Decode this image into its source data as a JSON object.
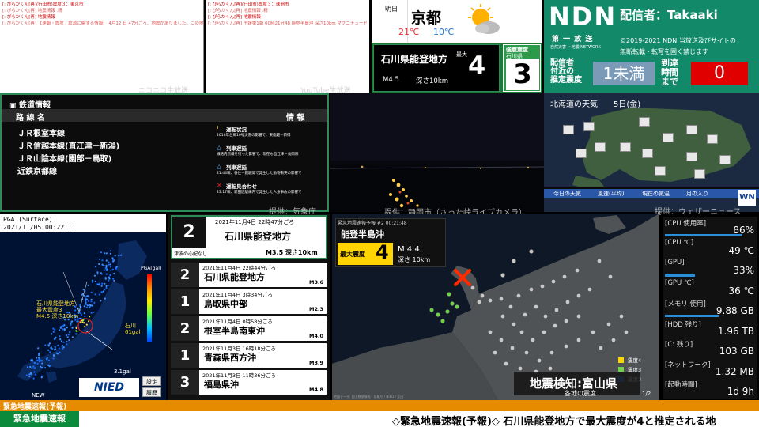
{
  "chat_niconico": {
    "lines": [
      "[: ぴらかくん[再](行田市)震度３：東京市",
      "[: ぴらかくん[再] 地震情報 .精",
      "[: ぴらかくん[再] 地震情報",
      "[: ぴらかくん[再] 【速報・震度 / 震源に関する情報】 4月12 日 47分ごろ、地震がありました。この地震による津波の心配はありません。震源地は石川県能登地方で、震源の深さは約10km、地震の規模（マグニチュード）はM4.5、最大震度は 3 と推定されます。",
      "[: ぴらかくん[再](行田市)震度３：珠洲市",
      "[: ぴらかくん[再] 地震情報 .精",
      "[: ぴらかくん[再] 地震情報",
      "[: ぴらかくん[再] 予報第1報 00時21分48 能登半島沖 深さ10km マグニチュード 4.4 予想震度3"
    ],
    "source": "ニコニコ生放送"
  },
  "chat_youtube": {
    "source": "YouTube生放送"
  },
  "weather": {
    "label": "明日",
    "city": "京都",
    "high": "21℃",
    "low": "10℃",
    "icon": "sun-cloud-icon"
  },
  "quake_top": {
    "region": "石川県能登地方",
    "max_label": "最大",
    "intensity": "4",
    "magnitude": "M4.5",
    "depth": "深さ10km",
    "obs_label": "強震震度",
    "obs_region": "石川県",
    "obs_intensity": "3"
  },
  "ndn": {
    "logo": "NDN",
    "sub": "第 一 放 送",
    "sub2": "自然災害 ・地震 NETWORK",
    "broadcaster": "配信者：Takaaki",
    "copyright": "©2019-2021 NDN 当放送及びサイトの",
    "notice": "無断転載・転写を固く禁じます",
    "local_label_1": "配信者",
    "local_label_2": "付近の",
    "local_label_3": "推定震度",
    "local_intensity": "1未満",
    "arrival_1": "到達",
    "arrival_2": "時間",
    "arrival_3": "まで",
    "arrival_seconds": "0"
  },
  "rail": {
    "title": "鉄道情報",
    "col_line": "路 線 名",
    "col_info": "情 報",
    "lines": [
      "ＪＲ根室本線",
      "ＪＲ信越本線(直江津－新潟)",
      "ＪＲ山陰本線(園部－鳥取)",
      "近鉄京都線"
    ],
    "notes": [
      {
        "title": "運転状況",
        "body": "2016年台風10号災害の影響で、東鹿越－新得"
      },
      {
        "title": "列車遅延",
        "body": "線路内点検を行った影響で、現在も直江津－長岡駅"
      },
      {
        "title": "列車遅延",
        "body": "21:44頃、香住－鎧駅間で発生した動物衝突の影響で"
      },
      {
        "title": "運転見合わせ",
        "body": "23:17頃、新田辺駅構内で発生した人身事故の影響で"
      }
    ],
    "source": "提供：気象庁"
  },
  "camera": {
    "source": "提供：静岡市（さった峠ライブカメラ）"
  },
  "hokkaido": {
    "title": "北海道の天気",
    "date": "5日(金)",
    "bar": [
      "今日の天気",
      "風速(平均)",
      "現在の気温",
      "月の入り"
    ],
    "logo": "WN",
    "source": "提供：ウェザーニュース"
  },
  "pga": {
    "title": "PGA (Surface)",
    "timestamp": "2021/11/05 00:22:11",
    "legend_title": "PGA[gal]",
    "epicenter_label_1": "石川県能登地方",
    "epicenter_label_2": "最大震度3",
    "epicenter_label_3": "M4.5 深さ10km",
    "peak_label_1": "石川",
    "peak_label_2": "61gal",
    "scale_value": "3.1gal",
    "new_badge": "NEW",
    "logo": "NIED",
    "btn_settings": "設定",
    "btn_history": "履歴"
  },
  "quake_list": {
    "headline": {
      "time": "2021年11月4日 22時47分ごろ",
      "place": "石川県能登地方",
      "intensity": "2",
      "tsunami": "津波の心配なし",
      "mag": "M3.5 深さ10km"
    },
    "items": [
      {
        "time": "2021年11月4日 22時44分ごろ",
        "place": "石川県能登地方",
        "intensity": "2",
        "mag": "M3.6"
      },
      {
        "time": "2021年11月4日 3時34分ごろ",
        "place": "鳥取県中部",
        "intensity": "1",
        "mag": "M2.3"
      },
      {
        "time": "2021年11月4日 0時58分ごろ",
        "place": "根室半島南東沖",
        "intensity": "2",
        "mag": "M4.0"
      },
      {
        "time": "2021年11月3日 16時18分ごろ",
        "place": "青森県西方沖",
        "intensity": "1",
        "mag": "M3.9"
      },
      {
        "time": "2021年11月3日 11時36分ごろ",
        "place": "福島県沖",
        "intensity": "3",
        "mag": "M4.8"
      }
    ]
  },
  "eew_map": {
    "header": "緊急地震速報予報 #2 00:21:48",
    "region": "能登半島沖",
    "max_label": "最大震度",
    "intensity": "4",
    "mag": "M 4.4",
    "depth": "深さ 10km",
    "detect": "地震検知:富山県",
    "legend_intensity": [
      "震度4",
      "震度3",
      "震度2"
    ],
    "legend_caption": "各地の震度",
    "page": "1/2",
    "credit": "地図データ: 国土数値情報 / 気象庁 / NIED / 友田"
  },
  "system": [
    {
      "label": "[CPU 使用率]",
      "value": "86%",
      "pct": 86
    },
    {
      "label": "[CPU ℃]",
      "value": "49 ℃",
      "pct": 0
    },
    {
      "label": "[GPU]",
      "value": "33%",
      "pct": 33
    },
    {
      "label": "[GPU ℃]",
      "value": "36 ℃",
      "pct": 0
    },
    {
      "label": "[メモリ 使用]",
      "value": "9.88 GB",
      "pct": 60
    },
    {
      "label": "[HDD 残り]",
      "value": "1.96 TB",
      "pct": 0
    },
    {
      "label": "[C: 残り]",
      "value": "103 GB",
      "pct": 0
    },
    {
      "label": "[ネットワーク]",
      "value": "1.32 MB",
      "pct": 0
    },
    {
      "label": "[起動時間]",
      "value": "1d 9h",
      "pct": 0
    }
  ],
  "ticker": {
    "top": "緊急地震速報(予報)",
    "badge": "緊急地震速報",
    "text": "◇緊急地震速報(予報)◇ 石川県能登地方で最大震度が4と推定される地"
  },
  "colors": {
    "ndn_green": "#128a6a",
    "quake_green": "#1b7a3a",
    "alert_red": "#e10000",
    "ticker_orange": "#e68a00",
    "badge_green": "#0a8a3a"
  }
}
